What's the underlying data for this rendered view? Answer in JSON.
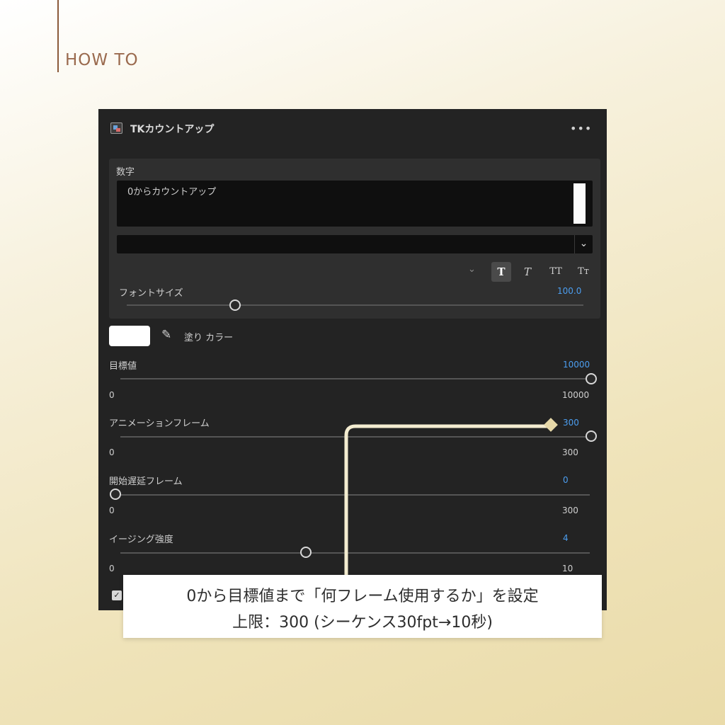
{
  "heading": "HOW TO",
  "panel": {
    "title": "TKカウントアップ",
    "more_icon": "more-horizontal-icon",
    "text_section": {
      "label": "数字",
      "text_value": "0からカウントアップ",
      "font_family_value": "",
      "style_buttons": [
        "T",
        "T",
        "TT",
        "Tт"
      ],
      "font_size_label": "フォントサイズ",
      "font_size_value": "100.0"
    },
    "fill": {
      "label": "塗り カラー",
      "color": "#ffffff"
    },
    "params": [
      {
        "label": "目標値",
        "value": "10000",
        "min": "0",
        "max": "10000",
        "level": 1.0
      },
      {
        "label": "アニメーションフレーム",
        "value": "300",
        "min": "0",
        "max": "300",
        "level": 1.0
      },
      {
        "label": "開始遅延フレーム",
        "value": "0",
        "min": "0",
        "max": "300",
        "level": 0.0
      },
      {
        "label": "イージング強度",
        "value": "4",
        "min": "0",
        "max": "10",
        "level": 0.4
      }
    ],
    "checkbox_checked": true
  },
  "callout": {
    "line1": "0から目標値まで「何フレーム使用するか」を設定",
    "line2": "上限：300 (シーケンス30fpt→10秒)"
  },
  "colors": {
    "accent": "#4c9ef0",
    "panel_bg": "#232323",
    "heading": "#9a6a4e",
    "connector": "#f3ecd0"
  }
}
